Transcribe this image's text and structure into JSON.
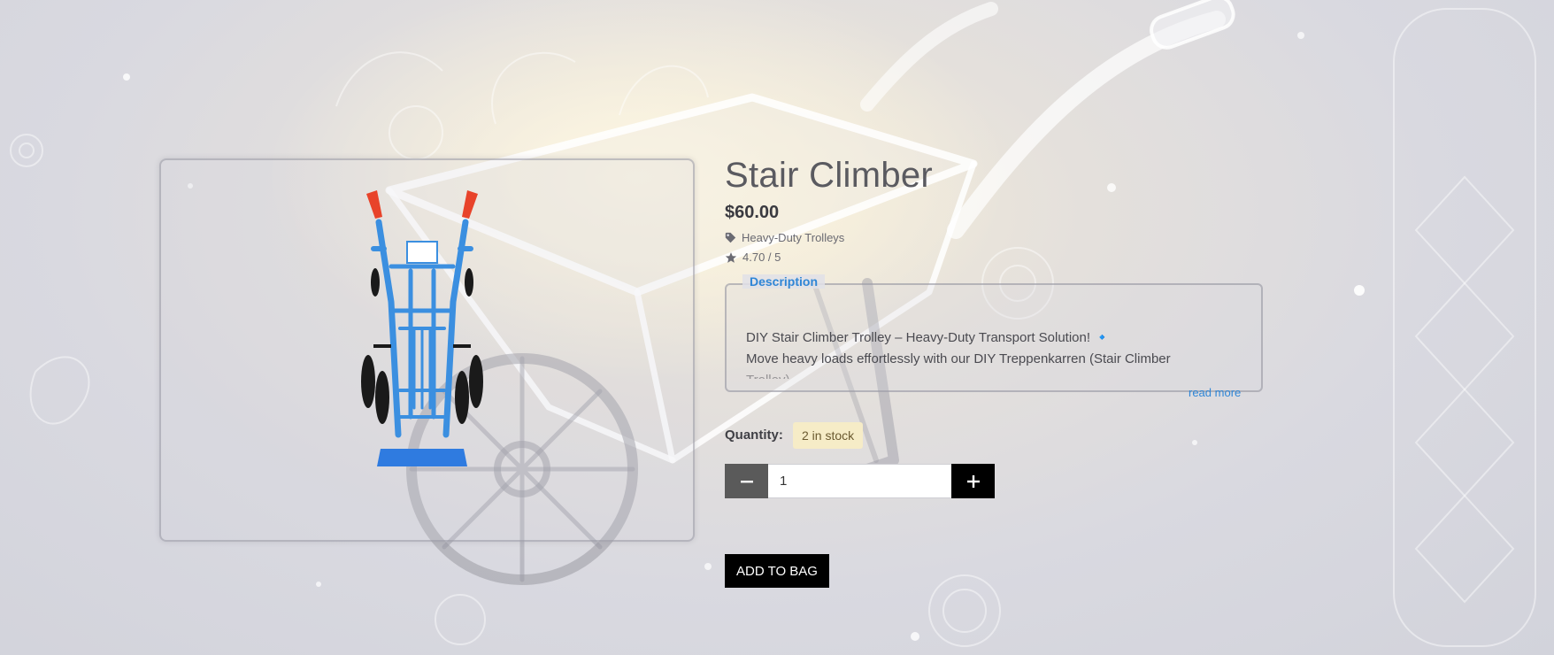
{
  "product": {
    "title": "Stair Climber",
    "price": "$60.00",
    "category": "Heavy-Duty Trolleys",
    "rating": "4.70 / 5",
    "image_alt": "Blue stair climber hand trolley"
  },
  "description": {
    "legend": "Description",
    "line1": "DIY Stair Climber Trolley – Heavy-Duty Transport Solution! 🔹",
    "line2": "Move heavy loads effortlessly with our DIY Treppenkarren (Stair Climber",
    "line3": "Trolley)",
    "read_more": "read more"
  },
  "purchase": {
    "quantity_label": "Quantity:",
    "stock": "2 in stock",
    "quantity_value": "1",
    "add_to_bag": "ADD TO BAG"
  },
  "icons": {
    "category": "tag-icon",
    "rating": "star-icon",
    "decrease": "minus-icon",
    "increase": "plus-icon"
  },
  "colors": {
    "accent": "#2f86d6",
    "stock_badge_bg": "#f6ecc7",
    "button_bg": "#000000",
    "trolley": "#3b8fe0"
  }
}
